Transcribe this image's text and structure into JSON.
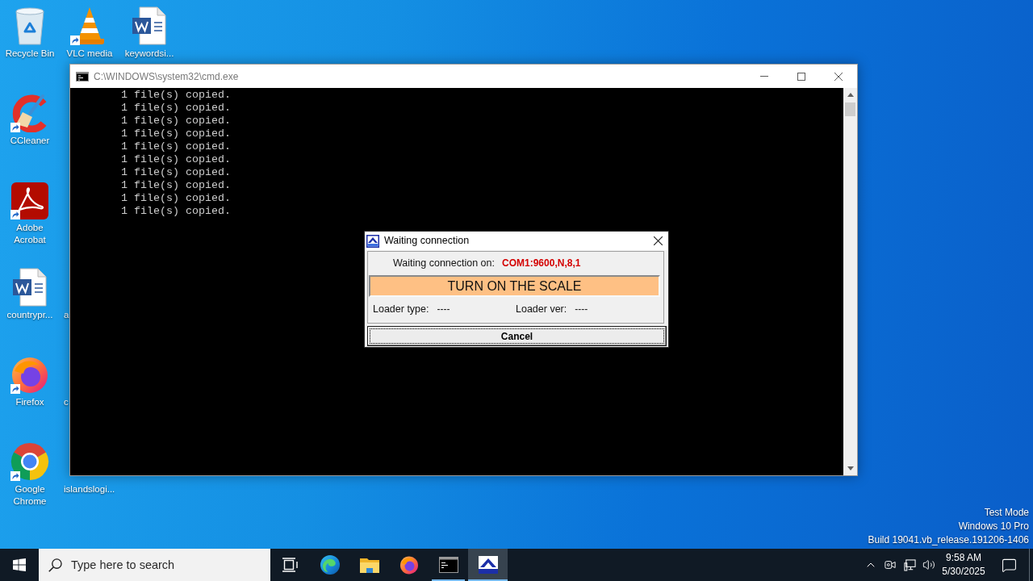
{
  "desktop_icons": [
    {
      "label": "Recycle Bin",
      "kind": "recyclebin",
      "shortcut": false
    },
    {
      "label": "CCleaner",
      "kind": "ccleaner",
      "shortcut": true
    },
    {
      "label": "Adobe Acrobat",
      "kind": "acrobat",
      "shortcut": true
    },
    {
      "label": "countrypr...",
      "kind": "document",
      "shortcut": false
    },
    {
      "label": "Firefox",
      "kind": "firefox",
      "shortcut": true
    },
    {
      "label": "Google Chrome",
      "kind": "chrome",
      "shortcut": true
    },
    {
      "label": "VLC media",
      "kind": "vlc",
      "shortcut": true
    },
    {
      "label": "a",
      "kind": "covered"
    },
    {
      "label": "c",
      "kind": "covered"
    },
    {
      "label": "islandslogi...",
      "kind": "covered"
    },
    {
      "label": "keywordsi...",
      "kind": "document",
      "shortcut": false
    }
  ],
  "cmd_window": {
    "title": "C:\\WINDOWS\\system32\\cmd.exe",
    "active": false,
    "lines": [
      "1 file(s) copied.",
      "1 file(s) copied.",
      "1 file(s) copied.",
      "1 file(s) copied.",
      "1 file(s) copied.",
      "1 file(s) copied.",
      "1 file(s) copied.",
      "1 file(s) copied.",
      "1 file(s) copied.",
      "1 file(s) copied."
    ]
  },
  "dialog": {
    "title": "Waiting connection",
    "waiting_label": "Waiting connection on:",
    "port": "COM1:9600,N,8,1",
    "banner": "TURN ON THE SCALE",
    "loader_type_label": "Loader type:",
    "loader_type": "----",
    "loader_ver_label": "Loader ver:",
    "loader_ver": "----",
    "cancel": "Cancel"
  },
  "desktop_info": [
    "Test Mode",
    "Windows 10 Pro",
    "Build 19041.vb_release.191206-1406"
  ],
  "taskbar": {
    "search": {
      "placeholder": "Type here to search"
    },
    "apps": [
      {
        "kind": "taskview",
        "running": false,
        "selected": false
      },
      {
        "kind": "edge",
        "running": false,
        "selected": false
      },
      {
        "kind": "explorer",
        "running": false,
        "selected": false
      },
      {
        "kind": "firefox",
        "running": false,
        "selected": false
      },
      {
        "kind": "terminal",
        "running": true,
        "selected": false
      },
      {
        "kind": "scaleapp",
        "running": true,
        "selected": true
      }
    ],
    "clock": {
      "time": "9:58 AM",
      "date": "5/30/2025"
    }
  }
}
